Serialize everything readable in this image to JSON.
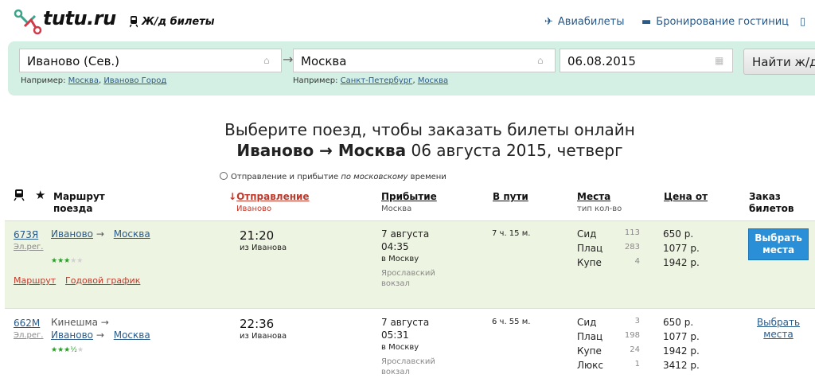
{
  "header": {
    "logo_text": "tutu.ru",
    "section_label": "Ж/д билеты",
    "links": [
      "Авиабилеты",
      "Бронирование гостиниц"
    ]
  },
  "search": {
    "from_value": "Иваново (Сев.)",
    "to_value": "Москва",
    "date_value": "06.08.2015",
    "find_button": "Найти ж/д б",
    "from_hint_prefix": "Например:",
    "from_hint_links": [
      "Москва",
      "Иваново Город"
    ],
    "to_hint_prefix": "Например:",
    "to_hint_links": [
      "Санкт-Петербург",
      "Москва"
    ]
  },
  "title": {
    "line1": "Выберите поезд, чтобы заказать билеты онлайн",
    "route": "Иваново → Москва",
    "date": "06 августа 2015, четверг"
  },
  "tz_note": {
    "prefix": "Отправление и прибытие",
    "emph": "по московскому",
    "suffix": "времени"
  },
  "table": {
    "headers": {
      "route": "Маршрут поезда",
      "departure": "Отправление",
      "departure_sub": "Иваново",
      "arrival": "Прибытие",
      "arrival_sub": "Москва",
      "duration": "В пути",
      "seats": "Места",
      "seats_sub": "тип кол-во",
      "price": "Цена от",
      "order": "Заказ билетов"
    },
    "rows": [
      {
        "number": "673Я",
        "type": "Эл.рег.",
        "route_from": "Иваново",
        "route_to": "Москва",
        "route_origin": "",
        "stars": 3,
        "extra_links": [
          "Маршрут",
          "Годовой график"
        ],
        "dep_time": "21:20",
        "dep_from": "из Иванова",
        "arr_date": "7 августа",
        "arr_time": "04:35",
        "arr_to": "в Москву",
        "arr_station": "Ярославский вокзал",
        "duration": "7 ч. 15 м.",
        "seats": [
          {
            "type": "Сид",
            "count": "113",
            "price": "650 р."
          },
          {
            "type": "Плац",
            "count": "283",
            "price": "1077 р."
          },
          {
            "type": "Купе",
            "count": "4",
            "price": "1942 р."
          }
        ],
        "order_label": "Выбрать места"
      },
      {
        "number": "662М",
        "type": "Эл.рег.",
        "route_origin": "Кинешма →",
        "route_from": "Иваново",
        "route_to": "Москва",
        "stars": 3.5,
        "extra_links": [],
        "dep_time": "22:36",
        "dep_from": "из Иванова",
        "arr_date": "7 августа",
        "arr_time": "05:31",
        "arr_to": "в Москву",
        "arr_station": "Ярославский вокзал",
        "duration": "6 ч. 55 м.",
        "seats": [
          {
            "type": "Сид",
            "count": "3",
            "price": "650 р."
          },
          {
            "type": "Плац",
            "count": "198",
            "price": "1077 р."
          },
          {
            "type": "Купе",
            "count": "24",
            "price": "1942 р."
          },
          {
            "type": "Люкс",
            "count": "1",
            "price": "3412 р."
          }
        ],
        "order_label": "Выбрать места"
      }
    ]
  },
  "colors": {
    "brand_teal": "#3aa58a",
    "panel_bg": "#d4efe4",
    "link": "#2a5a8a",
    "sorted_red": "#c0392b",
    "buy_button": "#2a8fd6",
    "row_highlight": "#eef4e2"
  }
}
